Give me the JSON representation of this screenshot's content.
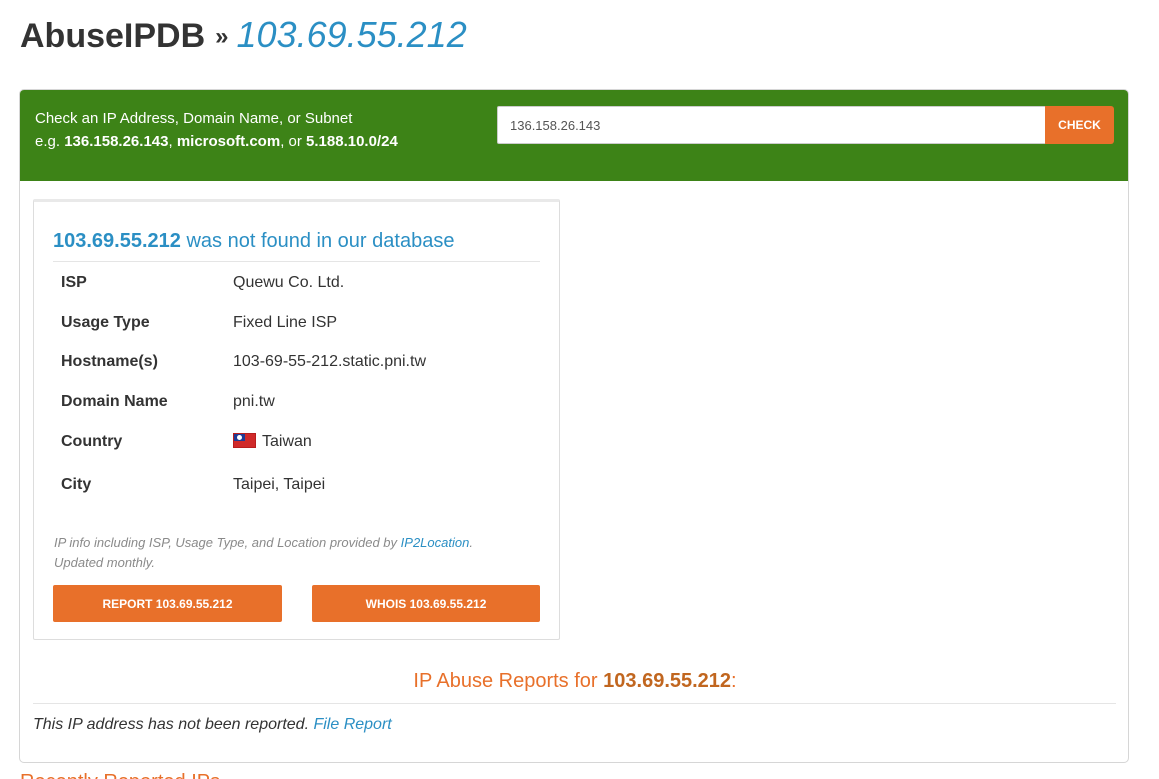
{
  "header": {
    "brand": "AbuseIPDB",
    "separator": "»",
    "ip": "103.69.55.212"
  },
  "check": {
    "prompt": "Check an IP Address, Domain Name, or Subnet",
    "example_prefix": "e.g.",
    "example_ip": "136.158.26.143",
    "example_sep1": ",",
    "example_domain": "microsoft.com",
    "example_sep2": ", or",
    "example_subnet": "5.188.10.0/24",
    "input_value": "136.158.26.143",
    "button_label": "CHECK"
  },
  "card": {
    "title_ip": "103.69.55.212",
    "title_text": "was not found in our database",
    "rows": [
      {
        "label": "ISP",
        "value": "Quewu Co. Ltd."
      },
      {
        "label": "Usage Type",
        "value": "Fixed Line ISP"
      },
      {
        "label": "Hostname(s)",
        "value": "103-69-55-212.static.pni.tw"
      },
      {
        "label": "Domain Name",
        "value": "pni.tw"
      },
      {
        "label": "Country",
        "value": "Taiwan",
        "icon": "taiwan-flag-icon"
      },
      {
        "label": "City",
        "value": "Taipei, Taipei"
      }
    ],
    "note_prefix": "IP info including ISP, Usage Type, and Location provided by",
    "note_link": "IP2Location",
    "note_suffix": ". Updated monthly.",
    "report_button": "REPORT 103.69.55.212",
    "whois_button": "WHOIS 103.69.55.212"
  },
  "reports": {
    "heading_prefix": "IP Abuse Reports for",
    "heading_ip": "103.69.55.212",
    "heading_suffix": ":",
    "not_reported_text": "This IP address has not been reported.",
    "file_report_link": "File Report"
  },
  "recent": {
    "heading": "Recently Reported IPs"
  },
  "colors": {
    "green": "#3d8317",
    "orange": "#e8702a",
    "blue": "#2b8fc4"
  }
}
